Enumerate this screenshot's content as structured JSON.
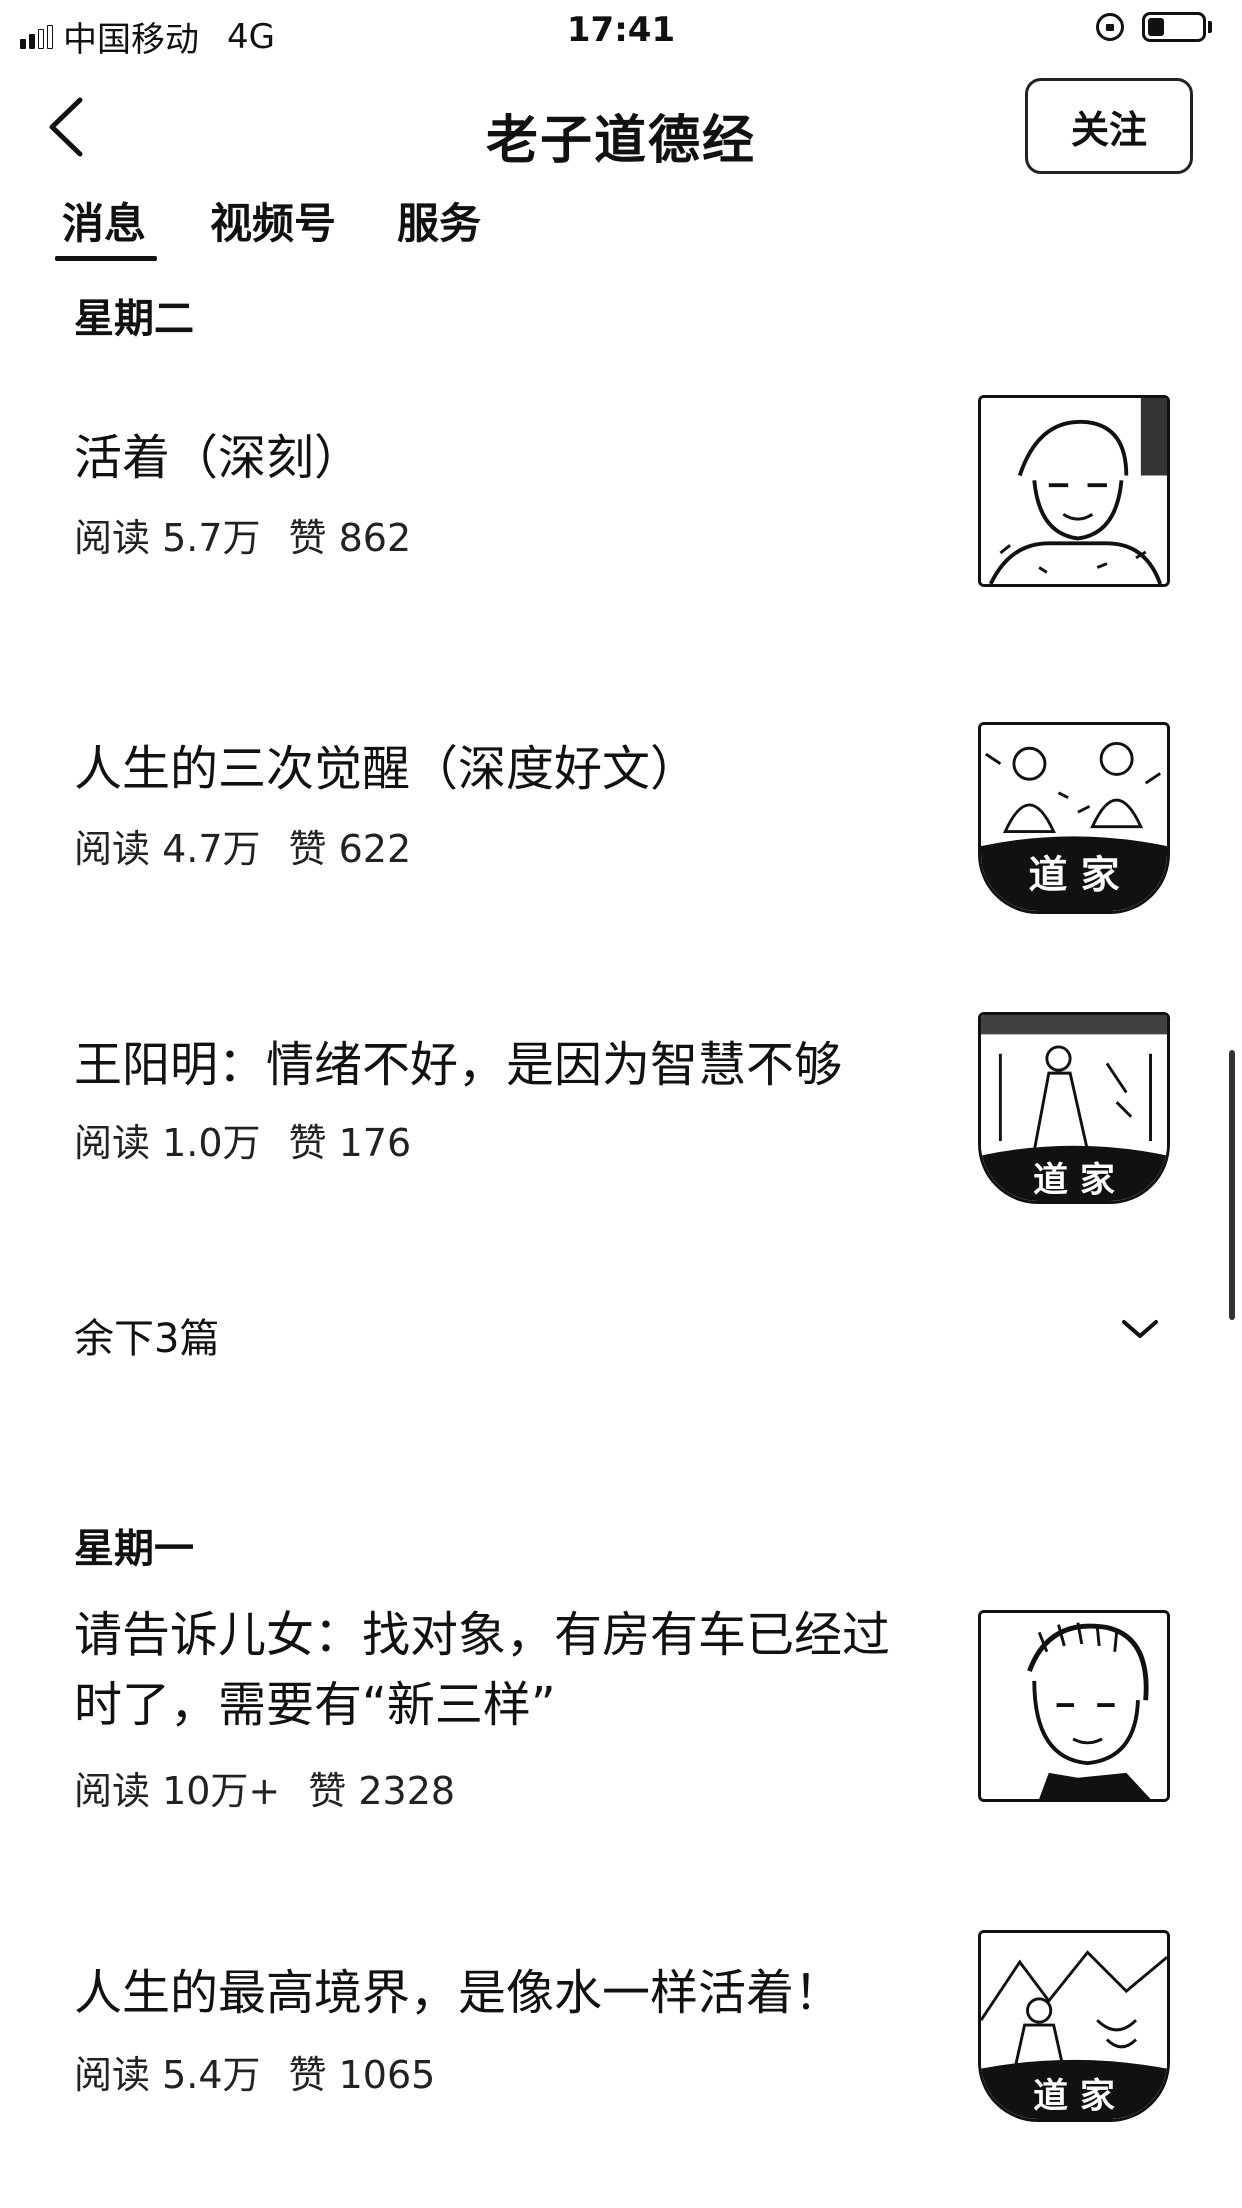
{
  "status_bar": {
    "carrier": "中国移动",
    "network": "4G",
    "time": "17:41"
  },
  "header": {
    "back_icon": "chevron-left-icon",
    "title": "老子道德经",
    "follow_label": "关注"
  },
  "tabs": [
    {
      "label": "消息",
      "active": true
    },
    {
      "label": "视频号",
      "active": false
    },
    {
      "label": "服务",
      "active": false
    }
  ],
  "groups": [
    {
      "day": "星期二",
      "articles": [
        {
          "title": "活着（深刻）",
          "reads": "阅读 5.7万",
          "likes": "赞 862",
          "thumb": "elderly-man-portrait"
        },
        {
          "title": "人生的三次觉醒（深度好文）",
          "reads": "阅读 4.7万",
          "likes": "赞 622",
          "thumb": "daojia-sages-scene"
        },
        {
          "title": "王阳明：情绪不好，是因为智慧不够",
          "reads": "阅读 1.0万",
          "likes": "赞 176",
          "thumb": "daojia-scholar-figure"
        }
      ],
      "more": "余下3篇"
    },
    {
      "day": "星期一",
      "articles": [
        {
          "title": "请告诉儿女：找对象，有房有车已经过时了，需要有“新三样”",
          "reads": "阅读 10万+",
          "likes": "赞 2328",
          "thumb": "woman-portrait"
        },
        {
          "title": "人生的最高境界，是像水一样活着！",
          "reads": "阅读 5.4万",
          "likes": "赞 1065",
          "thumb": "daojia-sage-landscape"
        }
      ]
    }
  ]
}
